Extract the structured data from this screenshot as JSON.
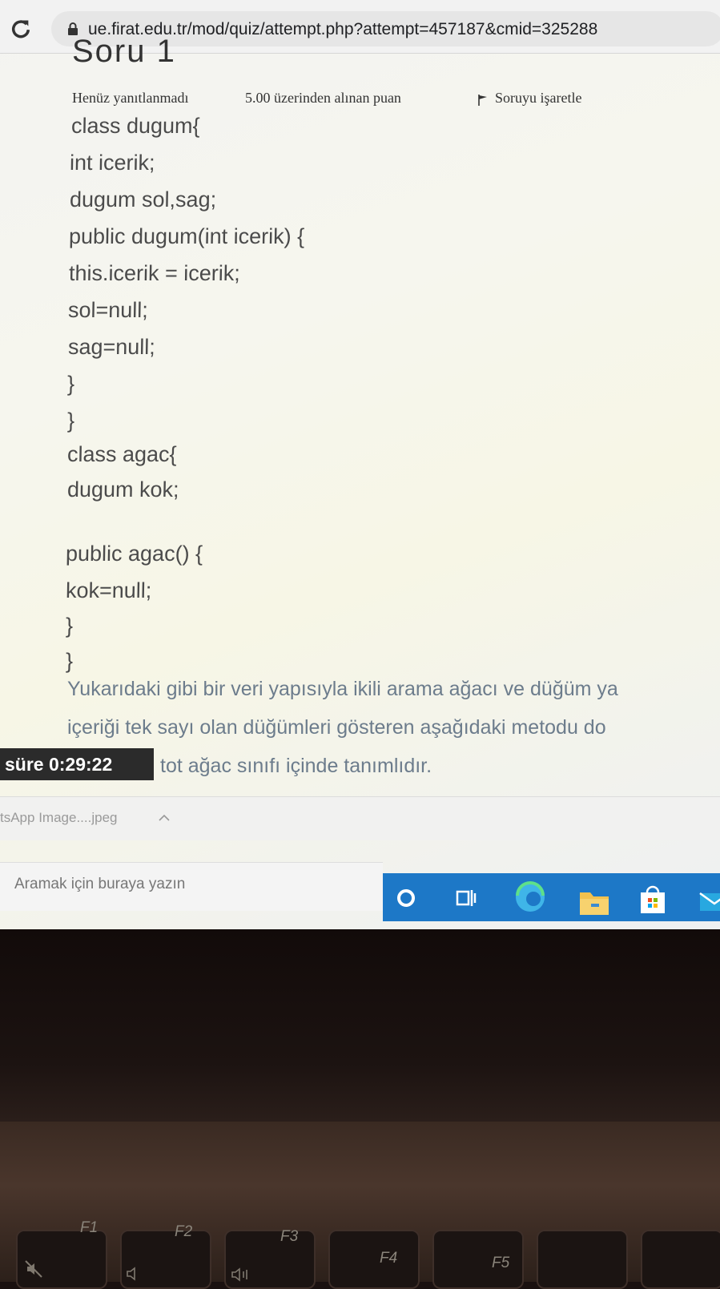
{
  "browser": {
    "url": "ue.firat.edu.tr/mod/quiz/attempt.php?attempt=457187&cmid=325288"
  },
  "question": {
    "title": "Soru 1",
    "status": "Henüz yanıtlanmadı",
    "points": "5.00 üzerinden alınan puan",
    "flag_label": "Soruyu işaretle",
    "code_lines": [
      "class dugum{",
      "int icerik;",
      "dugum sol,sag;",
      "public dugum(int icerik) {",
      "this.icerik = icerik;",
      "sol=null;",
      "sag=null;",
      "}",
      "}",
      "class agac{",
      "dugum kok;",
      "",
      "public agac() {",
      "kok=null;",
      "}",
      "}"
    ],
    "description_lines": [
      "Yukarıdaki gibi bir veri yapısıyla ikili arama ağacı ve düğüm ya",
      "içeriği tek sayı olan düğümleri gösteren aşağıdaki metodu do",
      "tot ağac sınıfı içinde tanımlıdır."
    ]
  },
  "timer": {
    "label": "süre",
    "value": "0:29:22"
  },
  "download": {
    "filename": "tsApp Image....jpeg"
  },
  "taskbar": {
    "search_placeholder": "Aramak için buraya yazın",
    "icons": [
      "cortana-icon",
      "task-view-icon",
      "edge-icon",
      "file-explorer-icon",
      "store-icon",
      "mail-icon"
    ],
    "accent_color": "#1d78c7"
  },
  "keyboard": {
    "keys": [
      "F1",
      "F2",
      "F3",
      "F4",
      "F5"
    ]
  }
}
